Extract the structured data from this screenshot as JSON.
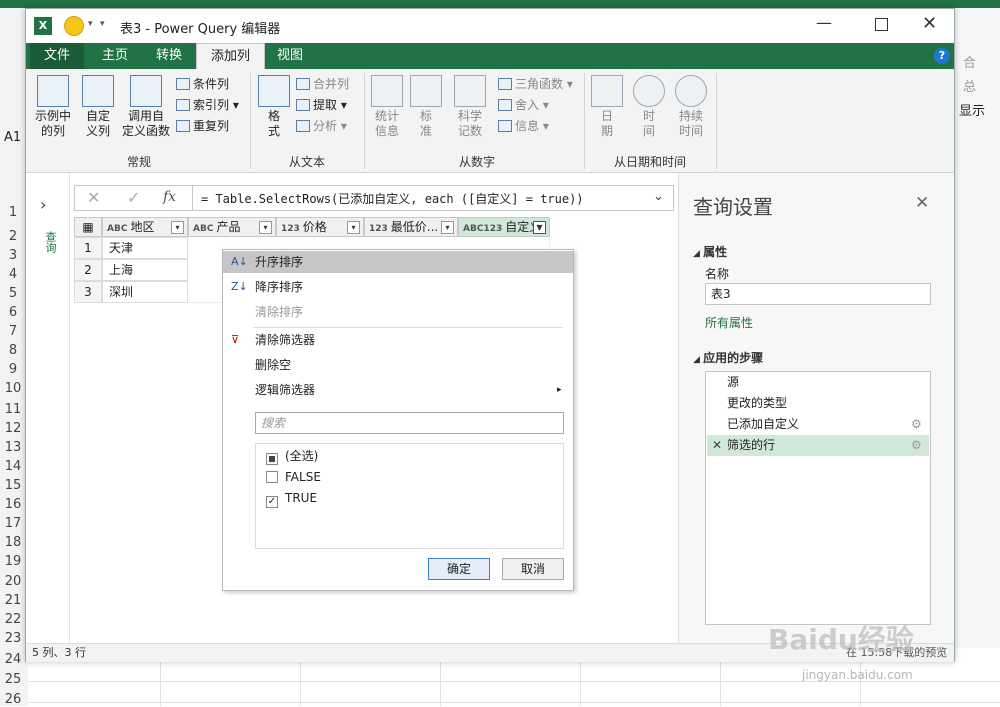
{
  "excel": {
    "row_numbers": [
      "1",
      "2",
      "3",
      "4",
      "5",
      "6",
      "7",
      "8",
      "9",
      "10",
      "11",
      "12",
      "13",
      "14",
      "15",
      "16",
      "17",
      "18",
      "19",
      "20",
      "21",
      "22",
      "23",
      "24",
      "25",
      "26"
    ],
    "cell_ref": "A1",
    "right_fragments": [
      "合",
      "总",
      "显示"
    ]
  },
  "window": {
    "title": "表3 - Power Query 编辑器",
    "tabs": [
      "文件",
      "主页",
      "转换",
      "添加列",
      "视图"
    ],
    "active_tab": "添加列",
    "help": "?"
  },
  "ribbon": {
    "general": {
      "label": "常规",
      "example_column": "示例中\n的列",
      "custom_column": "自定\n义列",
      "invoke_function": "调用自\n定义函数",
      "conditional_column": "条件列",
      "index_column": "索引列",
      "duplicate_column": "重复列"
    },
    "from_text": {
      "label": "从文本",
      "format": "格\n式",
      "merge_columns": "合并列",
      "extract": "提取",
      "parse": "分析"
    },
    "from_number": {
      "label": "从数字",
      "statistics": "统计\n信息",
      "standard": "标\n准",
      "scientific": "科学\n记数",
      "trigonometry": "三角函数",
      "rounding": "舍入",
      "information": "信息"
    },
    "from_datetime": {
      "label": "从日期和时间",
      "date": "日\n期",
      "time": "时\n间",
      "duration": "持续\n时间"
    }
  },
  "formula_bar": {
    "formula": "= Table.SelectRows(已添加自定义, each ([自定义] = true))"
  },
  "queries_pane_label": "查询",
  "table": {
    "headers": [
      {
        "type": "ABC",
        "label": "地区"
      },
      {
        "type": "ABC",
        "label": "产品"
      },
      {
        "type": "123",
        "label": "价格"
      },
      {
        "type": "123",
        "label": "最低价..."
      },
      {
        "type": "ABC123",
        "label": "自定义"
      }
    ],
    "rows": [
      {
        "n": "1",
        "region": "天津"
      },
      {
        "n": "2",
        "region": "上海"
      },
      {
        "n": "3",
        "region": "深圳"
      }
    ]
  },
  "filter_menu": {
    "sort_asc": "升序排序",
    "sort_desc": "降序排序",
    "clear_sort": "清除排序",
    "clear_filter": "清除筛选器",
    "remove_empty": "删除空",
    "logical_filters": "逻辑筛选器",
    "search_placeholder": "搜索",
    "options": [
      {
        "label": "(全选)",
        "state": "partial"
      },
      {
        "label": "FALSE",
        "state": "unchecked"
      },
      {
        "label": "TRUE",
        "state": "checked"
      }
    ],
    "ok": "确定",
    "cancel": "取消"
  },
  "query_settings": {
    "title": "查询设置",
    "properties_header": "属性",
    "name_label": "名称",
    "name_value": "表3",
    "all_properties": "所有属性",
    "applied_steps_header": "应用的步骤",
    "steps": [
      "源",
      "更改的类型",
      "已添加自定义",
      "筛选的行"
    ],
    "selected_step": "筛选的行"
  },
  "status": {
    "left": "5 列、3 行",
    "right": "在 15:58下载的预览"
  },
  "watermark": {
    "brand": "Baidu经验",
    "url": "jingyan.baidu.com"
  },
  "colors": {
    "excel_green": "#217346",
    "selected_step": "#cfe8d9",
    "menu_hover": "#c6c6c6"
  }
}
